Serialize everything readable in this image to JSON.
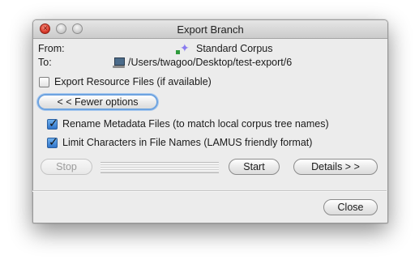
{
  "window": {
    "title": "Export Branch"
  },
  "export": {
    "from_label": "From:",
    "from_value": "Standard Corpus",
    "from_icon": "corpus-icon",
    "to_label": "To:",
    "to_value": "/Users/twagoo/Desktop/test-export/6",
    "to_icon": "computer-icon"
  },
  "options": {
    "export_resources": {
      "label": "Export Resource Files (if available)",
      "checked": false
    },
    "fewer_options_label": "< < Fewer options",
    "rename_metadata": {
      "label": "Rename Metadata Files (to match local corpus tree names)",
      "checked": true
    },
    "limit_characters": {
      "label": "Limit Characters in File Names (LAMUS friendly format)",
      "checked": true
    }
  },
  "actions": {
    "stop_label": "Stop",
    "stop_enabled": false,
    "progress": 0,
    "start_label": "Start",
    "details_label": "Details > >"
  },
  "footer": {
    "close_label": "Close"
  },
  "colors": {
    "window_bg": "#ececec",
    "check_accent": "#2f74c9",
    "focus_ring": "#6da3e0",
    "close_light": "#d8392a"
  }
}
